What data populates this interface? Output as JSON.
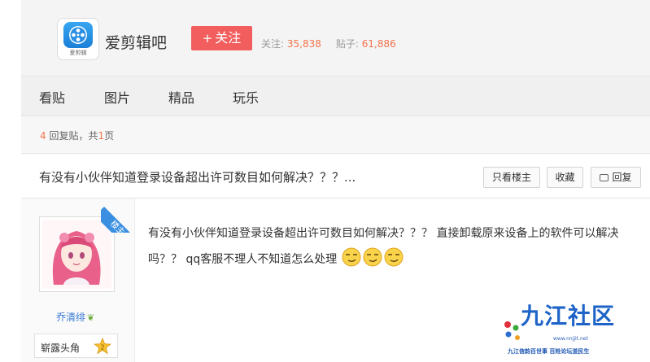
{
  "forum": {
    "logo_caption": "爱剪辑",
    "name": "爱剪辑吧",
    "follow_label": "关注",
    "follow_plus": "+",
    "followers_label": "关注:",
    "followers_count": "35,838",
    "posts_label": "贴子:",
    "posts_count": "61,886"
  },
  "tabs": [
    {
      "label": "看贴"
    },
    {
      "label": "图片"
    },
    {
      "label": "精品"
    },
    {
      "label": "玩乐"
    }
  ],
  "reply_info": {
    "count": "4",
    "replies_text": "回复贴，共",
    "pages": "1",
    "pages_unit": "页"
  },
  "thread": {
    "title": "有没有小伙伴知道登录设备超出许可数目如何解决？？？...",
    "buttons": {
      "only_op": "只看楼主",
      "favorite": "收藏",
      "reply": "回复"
    }
  },
  "post": {
    "op_badge": "楼主",
    "author_name": "乔清绯",
    "rank_title": "崭露头角",
    "rank_level": "2",
    "content": "有没有小伙伴知道登录设备超出许可数目如何解决？？？ 直接卸载原来设备上的软件可以解决吗？？ qq客服不理人不知道怎么处理",
    "emoji_count": 3
  },
  "watermark": {
    "title": "九江社区",
    "url": "www.nnjjit.net",
    "slogan": "九江信韵百世事  百姓论坛道民生"
  },
  "colors": {
    "accent_red": "#f25e5e",
    "number_orange": "#f2734c",
    "link_blue": "#3a7bd5",
    "badge_blue": "#3a8fe0"
  }
}
